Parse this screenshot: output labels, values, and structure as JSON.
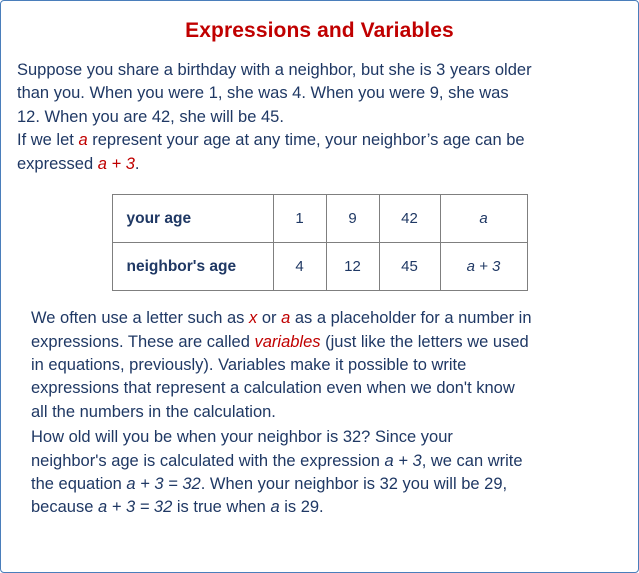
{
  "document": {
    "title": "Expressions and Variables",
    "title_color": "#c00000",
    "border_color": "#4a7ebb",
    "text_color": "#1f3864",
    "intro": {
      "line1": "Suppose you share a birthday with a neighbor, but she is 3 years older",
      "line2": "than you. When you were 1, she was 4. When you were 9, she was",
      "line3": "12. When you are 42, she will be 45.",
      "line4_a": "If we let ",
      "line4_var": "a",
      "line4_b": " represent your age at any time, your neighbor’s age can be",
      "line5_a": "expressed ",
      "line5_expr": "a + 3",
      "line5_b": "."
    },
    "table": {
      "rows": [
        {
          "label": "your age",
          "cells": [
            "1",
            "9",
            "42",
            "a"
          ]
        },
        {
          "label": "neighbor's age",
          "cells": [
            "4",
            "12",
            "45",
            "a + 3"
          ]
        }
      ]
    },
    "paragraph2": {
      "line1_a": "We often use a letter such as ",
      "line1_x": "x",
      "line1_b": " or ",
      "line1_a2": "a",
      "line1_c": " as a placeholder for a number in",
      "line2_a": "expressions. These are called ",
      "line2_variables": "variables",
      "line2_b": " (just like the letters we used",
      "line3": "in equations, previously). Variables make it possible to write",
      "line4": "expressions that represent a calculation even when we don't know",
      "line5": "all the numbers in the calculation."
    },
    "paragraph3": {
      "line1": "How old will you be when your neighbor is 32? Since your",
      "line2_a": "neighbor's age is calculated with the expression ",
      "line2_expr": "a + 3",
      "line2_b": ", we can write",
      "line3_a": "the equation  ",
      "line3_expr": "a + 3 = 32",
      "line3_b": ". When your neighbor is 32 you will be 29,",
      "line4_a": "because  ",
      "line4_expr": "a + 3 = 32",
      "line4_b": "  is true when ",
      "line4_var": "a",
      "line4_c": " is 29."
    }
  }
}
